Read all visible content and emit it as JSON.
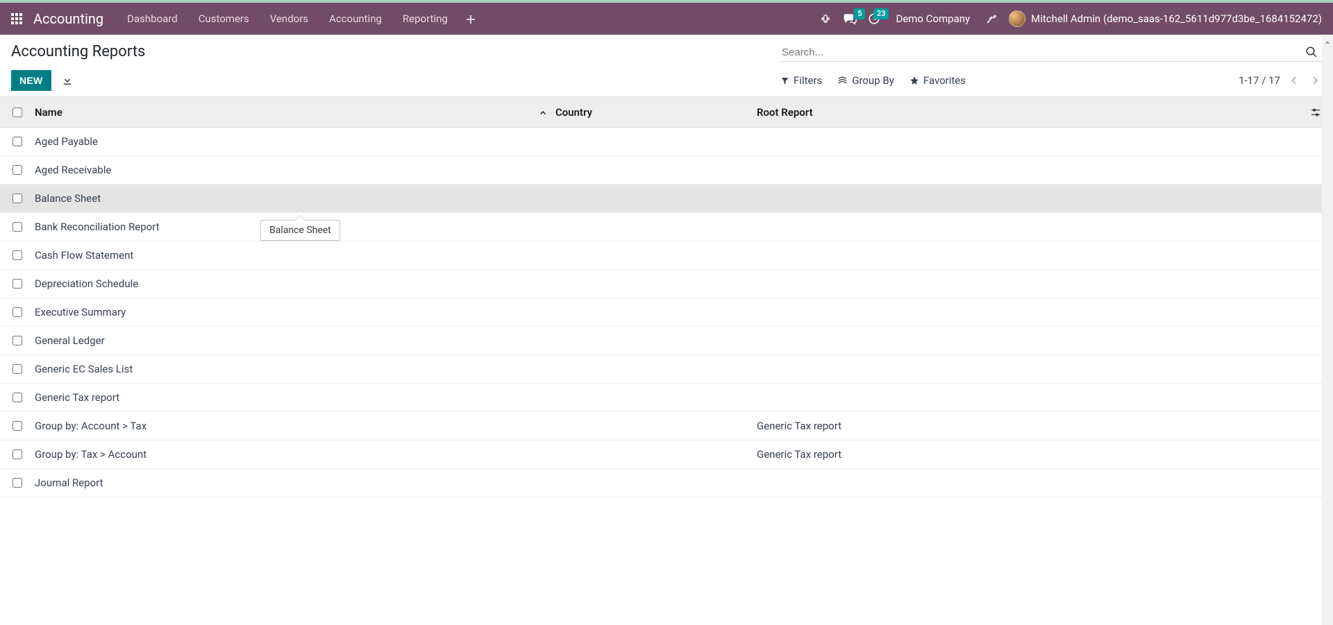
{
  "navbar": {
    "brand": "Accounting",
    "menu": [
      "Dashboard",
      "Customers",
      "Vendors",
      "Accounting",
      "Reporting"
    ],
    "messaging_badge": "5",
    "activities_badge": "23",
    "company": "Demo Company",
    "user": "Mitchell Admin (demo_saas-162_5611d977d3be_1684152472)"
  },
  "breadcrumb": "Accounting Reports",
  "buttons": {
    "new": "NEW"
  },
  "search": {
    "placeholder": "Search...",
    "filters": "Filters",
    "group_by": "Group By",
    "favorites": "Favorites"
  },
  "pager": {
    "text": "1-17 / 17"
  },
  "columns": {
    "name": "Name",
    "country": "Country",
    "root": "Root Report"
  },
  "tooltip": "Balance Sheet",
  "rows": [
    {
      "name": "Aged Payable",
      "country": "",
      "root": ""
    },
    {
      "name": "Aged Receivable",
      "country": "",
      "root": ""
    },
    {
      "name": "Balance Sheet",
      "country": "",
      "root": "",
      "hovered": true
    },
    {
      "name": "Bank Reconciliation Report",
      "country": "",
      "root": ""
    },
    {
      "name": "Cash Flow Statement",
      "country": "",
      "root": ""
    },
    {
      "name": "Depreciation Schedule",
      "country": "",
      "root": ""
    },
    {
      "name": "Executive Summary",
      "country": "",
      "root": ""
    },
    {
      "name": "General Ledger",
      "country": "",
      "root": ""
    },
    {
      "name": "Generic EC Sales List",
      "country": "",
      "root": ""
    },
    {
      "name": "Generic Tax report",
      "country": "",
      "root": ""
    },
    {
      "name": "Group by: Account > Tax",
      "country": "",
      "root": "Generic Tax report"
    },
    {
      "name": "Group by: Tax > Account",
      "country": "",
      "root": "Generic Tax report"
    },
    {
      "name": "Journal Report",
      "country": "",
      "root": ""
    }
  ]
}
